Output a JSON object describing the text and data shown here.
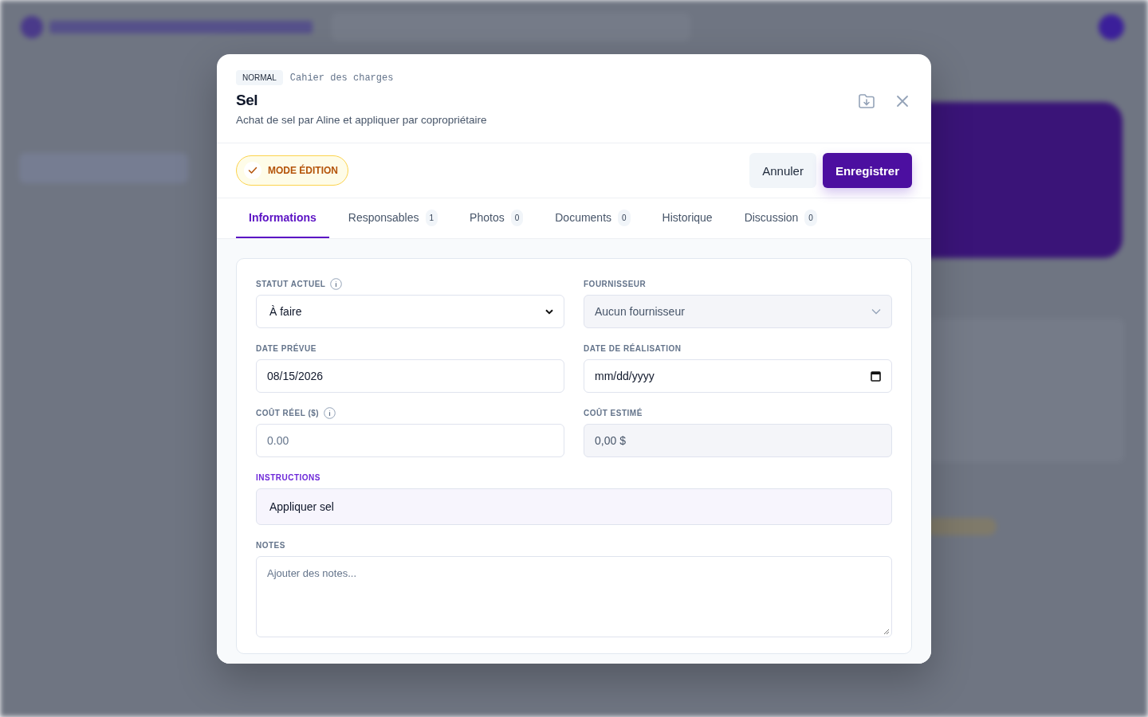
{
  "modal": {
    "priority_badge": "NORMAL",
    "category": "Cahier des charges",
    "title": "Sel",
    "description": "Achat de sel par Aline et appliquer par copropriétaire",
    "edit_mode": {
      "label": "MODE ÉDITION",
      "on": true
    },
    "buttons": [
      {
        "label": "Annuler",
        "kind": "secondary"
      },
      {
        "label": "Enregistrer",
        "kind": "primary"
      }
    ],
    "tabs": [
      {
        "label": "Informations",
        "selected": true
      },
      {
        "label": "Responsables",
        "count": "1",
        "selected": false
      },
      {
        "label": "Photos",
        "count": "0",
        "selected": false
      },
      {
        "label": "Documents",
        "count": "0",
        "selected": false
      },
      {
        "label": "Historique",
        "selected": false
      },
      {
        "label": "Discussion",
        "count": "0",
        "selected": false
      }
    ],
    "fields": [
      {
        "label": "STATUT ACTUEL",
        "info": true,
        "kind": "select",
        "value": "À faire",
        "disabled": false
      },
      {
        "label": "FOURNISSEUR",
        "kind": "select",
        "value": "Aucun fournisseur",
        "disabled": true
      },
      {
        "label": "DATE PRÉVUE",
        "kind": "text",
        "value": "08/15/2026",
        "disabled": false
      },
      {
        "label": "DATE DE RÉALISATION",
        "kind": "date",
        "placeholder": "mm/dd/yyyy",
        "disabled": false
      },
      {
        "label": "COÛT RÉEL ($)",
        "info": true,
        "kind": "text",
        "placeholder": "0.00",
        "disabled": false
      },
      {
        "label": "COÛT ESTIMÉ",
        "kind": "text",
        "value": "0,00 $",
        "disabled": true
      },
      {
        "label": "INSTRUCTIONS",
        "kind": "text",
        "value": "Appliquer sel",
        "wide": true,
        "highlighted": true,
        "disabled": false
      },
      {
        "label": "NOTES",
        "kind": "textarea",
        "placeholder": "Ajouter des notes...",
        "wide": true,
        "disabled": false
      }
    ]
  }
}
